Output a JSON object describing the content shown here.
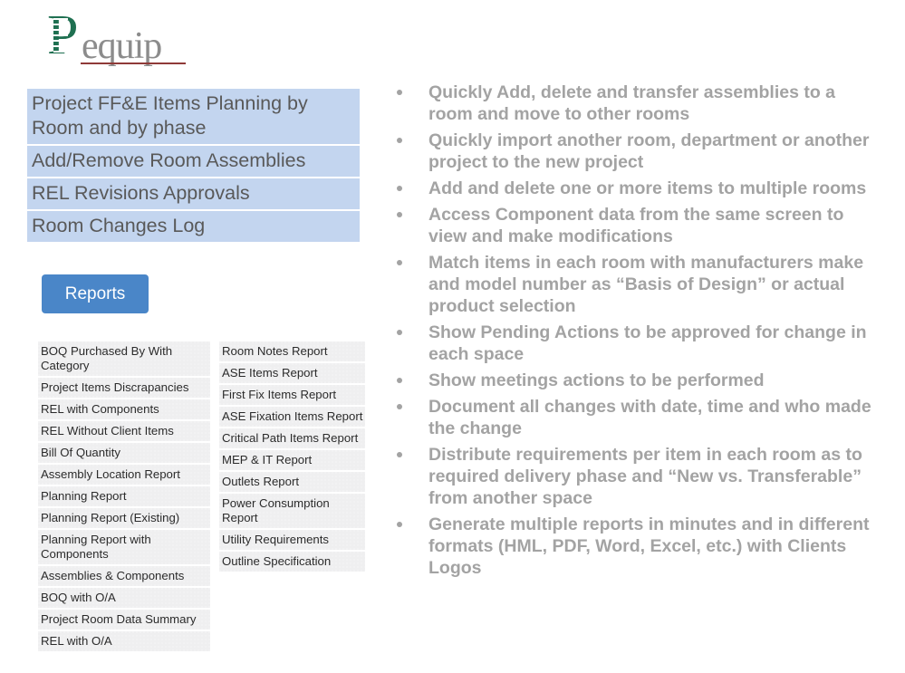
{
  "logo": {
    "mark": "P",
    "wordmark": "equip",
    "full_name": "Pequip",
    "green": "#1f7051",
    "gray": "#8c8c8c",
    "rule_color": "#8f3a38"
  },
  "feature_panel": {
    "accent_color": "#c3d5ef",
    "rows": [
      "Project FF&E Items Planning by Room and by phase",
      "Add/Remove Room Assemblies",
      "REL Revisions Approvals",
      "Room Changes Log"
    ]
  },
  "reports_button": {
    "label": "Reports",
    "color": "#4a86c8"
  },
  "reports": {
    "left_column": [
      "BOQ Purchased By With Category",
      "Project Items Discrapancies",
      "REL with Components",
      "REL Without Client Items",
      "Bill Of Quantity",
      "Assembly Location Report",
      "Planning Report",
      "Planning Report (Existing)",
      "Planning Report with Components",
      "Assemblies & Components",
      "BOQ with O/A",
      "Project Room Data Summary",
      "REL with O/A"
    ],
    "right_column": [
      "Room Notes Report",
      "ASE Items Report",
      "First Fix Items Report",
      "ASE Fixation Items Report",
      "Critical Path Items Report",
      "MEP & IT Report",
      "Outlets Report",
      "Power Consumption Report",
      "Utility Requirements",
      "Outline Specification"
    ]
  },
  "benefits": {
    "text_color": "#a3a3a3",
    "items": [
      "Quickly Add, delete and transfer assemblies to a room and move to other rooms",
      "Quickly import another room, department or another project to the new project",
      "Add and delete one or more items to multiple rooms",
      "Access Component data from the same screen to view and make modifications",
      "Match items in each room with manufacturers make and model number as “Basis of Design” or actual product selection",
      "Show Pending Actions to be approved  for change in each space",
      "Show meetings actions to be performed",
      "Document all changes with date, time and who made the change",
      "Distribute requirements per item in each room as to required delivery phase and “New vs. Transferable” from another space",
      "Generate multiple reports in minutes and in different formats (HML, PDF, Word, Excel, etc.) with Clients Logos"
    ]
  }
}
